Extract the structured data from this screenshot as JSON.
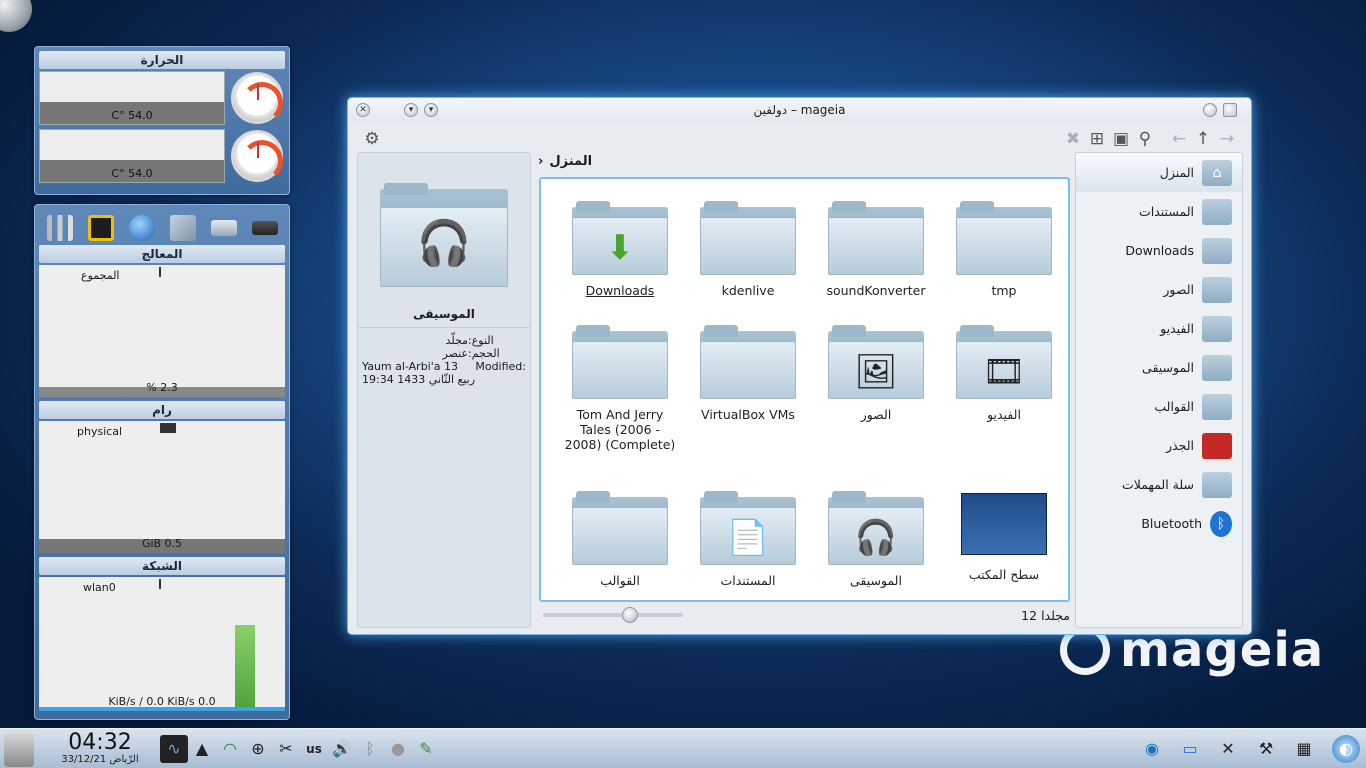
{
  "brand": {
    "text": "mageia"
  },
  "temp_widget": {
    "title": "الحرارة",
    "readings": [
      "C° 54.0",
      "C° 54.0"
    ]
  },
  "monitor_widget": {
    "cpu": {
      "title": "المعالج",
      "label": "المجموع",
      "value": "% 2.3"
    },
    "ram": {
      "title": "رام",
      "label": "physical",
      "value": "GiB 0.5"
    },
    "net": {
      "title": "الشبكة",
      "label": "wlan0",
      "value": "KiB/s / 0.0 KiB/s 0.0"
    }
  },
  "window": {
    "title": "دولفين – mageia",
    "breadcrumb": "المنزل",
    "info": {
      "name": "الموسيقى",
      "type_key": "النوع:",
      "type_val": "مجلّد",
      "size_key": "الحجم:",
      "size_val": "عنصر",
      "mod_key": "Modified:",
      "mod_val": "Yaum al-Arbi'a 13 ربيع الثّاني 1433 19:34"
    },
    "items": [
      {
        "label": "tmp",
        "kind": "folder"
      },
      {
        "label": "soundKonverter",
        "kind": "folder"
      },
      {
        "label": "kdenlive",
        "kind": "folder"
      },
      {
        "label": "Downloads",
        "kind": "download"
      },
      {
        "label": "الفيديو",
        "kind": "video"
      },
      {
        "label": "الصور",
        "kind": "pictures"
      },
      {
        "label": "VirtualBox VMs",
        "kind": "folder"
      },
      {
        "label": "Tom And Jerry Tales (2006 - 2008) (Complete)",
        "kind": "folder"
      },
      {
        "label": "سطح المكتب",
        "kind": "desktop"
      },
      {
        "label": "الموسيقى",
        "kind": "music"
      },
      {
        "label": "المستندات",
        "kind": "documents"
      },
      {
        "label": "القوالب",
        "kind": "folder"
      }
    ],
    "status": "12 مجلدا",
    "zoom_fraction": 0.62,
    "places": [
      {
        "label": "المنزل",
        "icon": "home-icon"
      },
      {
        "label": "المستندات",
        "icon": "documents-icon"
      },
      {
        "label": "Downloads",
        "icon": "downloads-icon"
      },
      {
        "label": "الصور",
        "icon": "pictures-icon"
      },
      {
        "label": "الفيديو",
        "icon": "video-icon"
      },
      {
        "label": "الموسيقى",
        "icon": "music-icon"
      },
      {
        "label": "القوالب",
        "icon": "templates-icon"
      },
      {
        "label": "الجذر",
        "icon": "root-icon"
      },
      {
        "label": "سلة المهملات",
        "icon": "trash-icon"
      },
      {
        "label": "Bluetooth",
        "icon": "bluetooth-icon"
      }
    ]
  },
  "panel": {
    "time": "04:32",
    "date": "33/12/21 الرّباض",
    "lang": "us"
  }
}
